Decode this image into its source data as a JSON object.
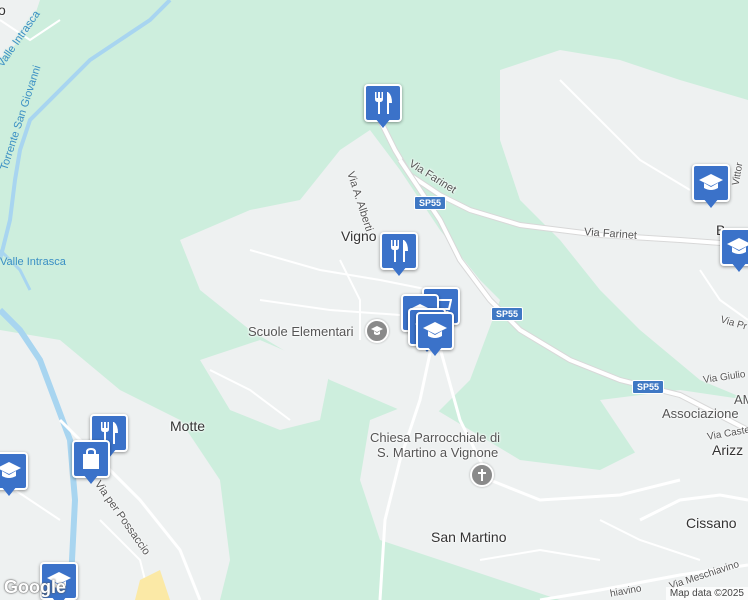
{
  "colors": {
    "forest": "#cdeedd",
    "urban": "#f1f3f4",
    "road": "#ffffff",
    "water": "#a8d5f0",
    "marker": "#3b72c9"
  },
  "places": {
    "vignone": "Vigno",
    "motte": "Motte",
    "san_martino": "San Martino",
    "cissano": "Cissano",
    "arizz": "Arizz",
    "b_partial": "B",
    "scuole": "Scuole Elementari",
    "chiesa_1": "Chiesa Parrocchiale di",
    "chiesa_2": "S. Martino a Vignone",
    "associazione": "Associazione",
    "am_partial": "AM",
    "o_partial": "o"
  },
  "roads": {
    "via_farinet_1": "Via Farinet",
    "via_farinet_2": "Via Farinet",
    "via_alberti": "Via A. Alberti",
    "via_per_possaccio": "Via per Possaccio",
    "via_giulio": "Via Giulio",
    "via_castel": "Via Castel",
    "via_pr": "Via Pr",
    "via_meschiavino": "Via Meschiavino",
    "meschiavino_partial": "hiavino",
    "vittorio": "Vittor"
  },
  "water_labels": {
    "torrente": "Torrente San Giovanni",
    "valle_intrasca_1": "Valle Intrasca",
    "valle_intrasca_2": "Valle Intrasca"
  },
  "shields": {
    "sp55_a": "SP55",
    "sp55_b": "SP55",
    "sp55_c": "SP55"
  },
  "markers": [
    {
      "name": "restaurant-marker",
      "icon": "fork-knife-icon"
    },
    {
      "name": "restaurant-marker",
      "icon": "fork-knife-icon"
    },
    {
      "name": "school-marker",
      "icon": "graduation-cap-icon"
    },
    {
      "name": "supermarket-marker",
      "icon": "shopping-cart-icon"
    },
    {
      "name": "school-marker",
      "icon": "graduation-cap-icon"
    },
    {
      "name": "school-marker",
      "icon": "graduation-cap-icon"
    },
    {
      "name": "restaurant-marker",
      "icon": "fork-knife-icon"
    },
    {
      "name": "shopping-marker",
      "icon": "shopping-bag-icon"
    },
    {
      "name": "school-marker",
      "icon": "graduation-cap-icon"
    },
    {
      "name": "school-marker",
      "icon": "graduation-cap-icon"
    },
    {
      "name": "school-marker",
      "icon": "graduation-cap-icon"
    }
  ],
  "footer": {
    "logo": "Google",
    "attribution": "Map data ©2025"
  }
}
